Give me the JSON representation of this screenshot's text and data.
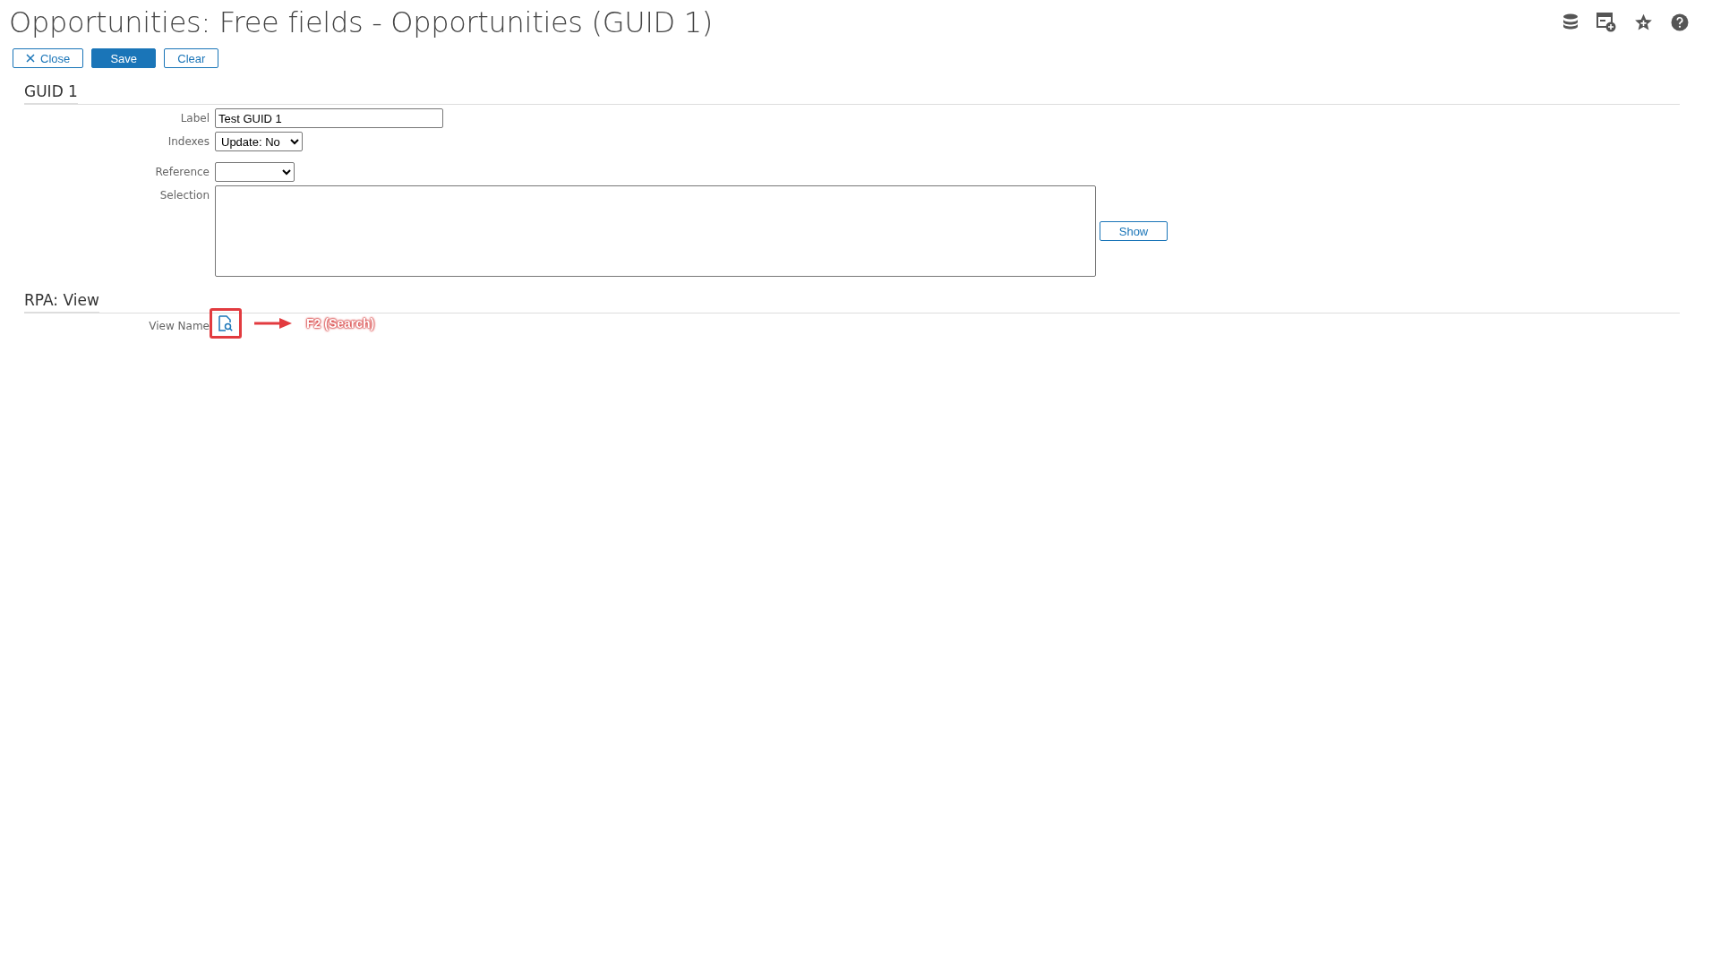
{
  "title": "Opportunities: Free fields - Opportunities (GUID 1)",
  "toolbar": [
    {
      "label": "Close",
      "kind": "close",
      "primary": false
    },
    {
      "label": "Save",
      "kind": "plain",
      "primary": true
    },
    {
      "label": "Clear",
      "kind": "plain",
      "primary": false
    }
  ],
  "sections": [
    {
      "title": "GUID 1",
      "fields": [
        {
          "kind": "text",
          "label": "Label",
          "value": "Test GUID 1"
        },
        {
          "kind": "select",
          "label": "Indexes",
          "value": "Update: No"
        },
        {
          "kind": "select",
          "label": "Reference"
        },
        {
          "kind": "textarea",
          "label": "Selection",
          "button": "Show"
        }
      ]
    },
    {
      "title": "RPA: View",
      "fields": [
        {
          "kind": "lookup",
          "label": "View Name",
          "annotation": "F2 (Search)"
        }
      ]
    }
  ]
}
